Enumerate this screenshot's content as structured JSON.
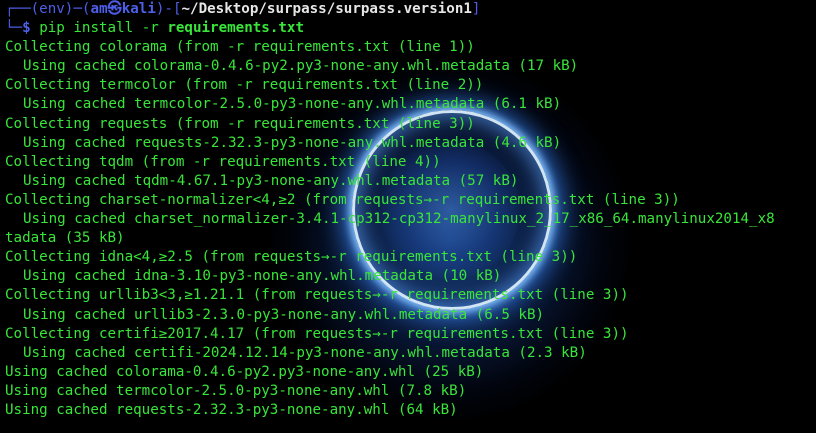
{
  "prompt": {
    "corner_top": "┌──",
    "env": "(env)",
    "sep1": "─(",
    "user_host": "am㉿kali",
    "sep2": ")-[",
    "path": "~/Desktop/surpass/surpass.version1",
    "close": "]",
    "corner_bottom": "└─",
    "dollar": "$",
    "command": "pip",
    "args": "install -r",
    "file": "requirements.txt"
  },
  "output": [
    {
      "text": "Collecting colorama (from -r requirements.txt (line 1))",
      "indent": false
    },
    {
      "text": "Using cached colorama-0.4.6-py2.py3-none-any.whl.metadata (17 kB)",
      "indent": true
    },
    {
      "text": "Collecting termcolor (from -r requirements.txt (line 2))",
      "indent": false
    },
    {
      "text": "Using cached termcolor-2.5.0-py3-none-any.whl.metadata (6.1 kB)",
      "indent": true
    },
    {
      "text": "Collecting requests (from -r requirements.txt (line 3))",
      "indent": false
    },
    {
      "text": "Using cached requests-2.32.3-py3-none-any.whl.metadata (4.6 kB)",
      "indent": true
    },
    {
      "text": "Collecting tqdm (from -r requirements.txt (line 4))",
      "indent": false
    },
    {
      "text": "Using cached tqdm-4.67.1-py3-none-any.whl.metadata (57 kB)",
      "indent": true
    },
    {
      "text": "Collecting charset-normalizer<4,≥2 (from requests→-r requirements.txt (line 3))",
      "indent": false
    },
    {
      "text": "Using cached charset_normalizer-3.4.1-cp312-cp312-manylinux_2_17_x86_64.manylinux2014_x8",
      "indent": true
    },
    {
      "text": "tadata (35 kB)",
      "indent": false
    },
    {
      "text": "Collecting idna<4,≥2.5 (from requests→-r requirements.txt (line 3))",
      "indent": false
    },
    {
      "text": "Using cached idna-3.10-py3-none-any.whl.metadata (10 kB)",
      "indent": true
    },
    {
      "text": "Collecting urllib3<3,≥1.21.1 (from requests→-r requirements.txt (line 3))",
      "indent": false
    },
    {
      "text": "Using cached urllib3-2.3.0-py3-none-any.whl.metadata (6.5 kB)",
      "indent": true
    },
    {
      "text": "Collecting certifi≥2017.4.17 (from requests→-r requirements.txt (line 3))",
      "indent": false
    },
    {
      "text": "Using cached certifi-2024.12.14-py3-none-any.whl.metadata (2.3 kB)",
      "indent": true
    },
    {
      "text": "Using cached colorama-0.4.6-py2.py3-none-any.whl (25 kB)",
      "indent": false
    },
    {
      "text": "Using cached termcolor-2.5.0-py3-none-any.whl (7.8 kB)",
      "indent": false
    },
    {
      "text": "Using cached requests-2.32.3-py3-none-any.whl (64 kB)",
      "indent": false
    }
  ]
}
